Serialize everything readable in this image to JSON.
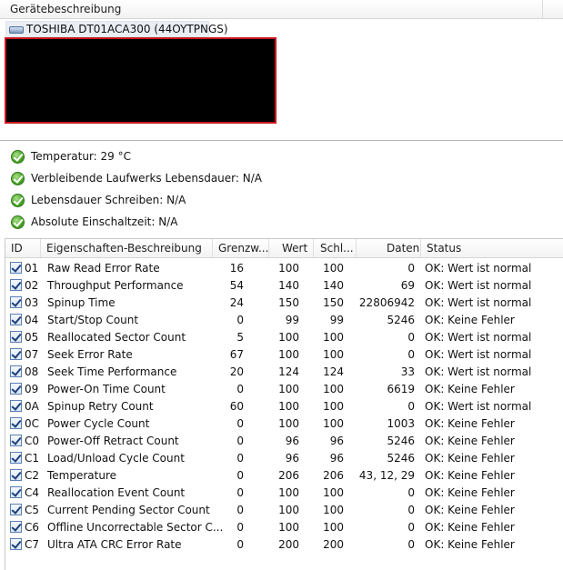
{
  "panel": {
    "title": "Gerätebeschreibung"
  },
  "device": {
    "name": "TOSHIBA DT01ACA300 (44OYTPNGS)",
    "icon": "hard-drive-icon"
  },
  "status": [
    {
      "icon": "check-icon",
      "text": "Temperatur: 29 °C"
    },
    {
      "icon": "check-icon",
      "text": "Verbleibende Laufwerks Lebensdauer: N/A"
    },
    {
      "icon": "check-icon",
      "text": "Lebensdauer Schreiben: N/A"
    },
    {
      "icon": "check-icon",
      "text": "Absolute Einschaltzeit: N/A"
    }
  ],
  "table": {
    "columns": [
      "ID",
      "Eigenschaften-Beschreibung",
      "Grenzw...",
      "Wert",
      "Schl...",
      "Daten",
      "Status"
    ],
    "rows": [
      {
        "checked": true,
        "id": "01",
        "desc": "Raw Read Error Rate",
        "threshold": "16",
        "value": "100",
        "worst": "100",
        "data": "0",
        "status": "OK: Wert ist normal"
      },
      {
        "checked": true,
        "id": "02",
        "desc": "Throughput Performance",
        "threshold": "54",
        "value": "140",
        "worst": "140",
        "data": "69",
        "status": "OK: Wert ist normal"
      },
      {
        "checked": true,
        "id": "03",
        "desc": "Spinup Time",
        "threshold": "24",
        "value": "150",
        "worst": "150",
        "data": "22806942",
        "status": "OK: Wert ist normal"
      },
      {
        "checked": true,
        "id": "04",
        "desc": "Start/Stop Count",
        "threshold": "0",
        "value": "99",
        "worst": "99",
        "data": "5246",
        "status": "OK: Keine Fehler"
      },
      {
        "checked": true,
        "id": "05",
        "desc": "Reallocated Sector Count",
        "threshold": "5",
        "value": "100",
        "worst": "100",
        "data": "0",
        "status": "OK: Wert ist normal"
      },
      {
        "checked": true,
        "id": "07",
        "desc": "Seek Error Rate",
        "threshold": "67",
        "value": "100",
        "worst": "100",
        "data": "0",
        "status": "OK: Wert ist normal"
      },
      {
        "checked": true,
        "id": "08",
        "desc": "Seek Time Performance",
        "threshold": "20",
        "value": "124",
        "worst": "124",
        "data": "33",
        "status": "OK: Wert ist normal"
      },
      {
        "checked": true,
        "id": "09",
        "desc": "Power-On Time Count",
        "threshold": "0",
        "value": "100",
        "worst": "100",
        "data": "6619",
        "status": "OK: Keine Fehler"
      },
      {
        "checked": true,
        "id": "0A",
        "desc": "Spinup Retry Count",
        "threshold": "60",
        "value": "100",
        "worst": "100",
        "data": "0",
        "status": "OK: Wert ist normal"
      },
      {
        "checked": true,
        "id": "0C",
        "desc": "Power Cycle Count",
        "threshold": "0",
        "value": "100",
        "worst": "100",
        "data": "1003",
        "status": "OK: Keine Fehler"
      },
      {
        "checked": true,
        "id": "C0",
        "desc": "Power-Off Retract Count",
        "threshold": "0",
        "value": "96",
        "worst": "96",
        "data": "5246",
        "status": "OK: Keine Fehler"
      },
      {
        "checked": true,
        "id": "C1",
        "desc": "Load/Unload Cycle Count",
        "threshold": "0",
        "value": "96",
        "worst": "96",
        "data": "5246",
        "status": "OK: Keine Fehler"
      },
      {
        "checked": true,
        "id": "C2",
        "desc": "Temperature",
        "threshold": "0",
        "value": "206",
        "worst": "206",
        "data": "43, 12, 29",
        "status": "OK: Keine Fehler"
      },
      {
        "checked": true,
        "id": "C4",
        "desc": "Reallocation Event Count",
        "threshold": "0",
        "value": "100",
        "worst": "100",
        "data": "0",
        "status": "OK: Keine Fehler"
      },
      {
        "checked": true,
        "id": "C5",
        "desc": "Current Pending Sector Count",
        "threshold": "0",
        "value": "100",
        "worst": "100",
        "data": "0",
        "status": "OK: Keine Fehler"
      },
      {
        "checked": true,
        "id": "C6",
        "desc": "Offline Uncorrectable Sector C...",
        "threshold": "0",
        "value": "100",
        "worst": "100",
        "data": "0",
        "status": "OK: Keine Fehler"
      },
      {
        "checked": true,
        "id": "C7",
        "desc": "Ultra ATA CRC Error Rate",
        "threshold": "0",
        "value": "200",
        "worst": "200",
        "data": "0",
        "status": "OK: Keine Fehler"
      }
    ]
  }
}
